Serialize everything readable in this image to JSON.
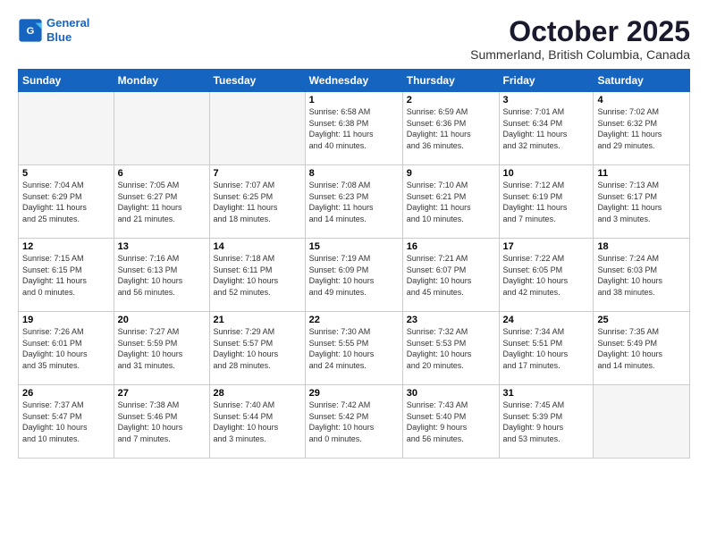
{
  "header": {
    "logo_line1": "General",
    "logo_line2": "Blue",
    "month": "October 2025",
    "location": "Summerland, British Columbia, Canada"
  },
  "weekdays": [
    "Sunday",
    "Monday",
    "Tuesday",
    "Wednesday",
    "Thursday",
    "Friday",
    "Saturday"
  ],
  "weeks": [
    [
      {
        "day": "",
        "info": ""
      },
      {
        "day": "",
        "info": ""
      },
      {
        "day": "",
        "info": ""
      },
      {
        "day": "1",
        "info": "Sunrise: 6:58 AM\nSunset: 6:38 PM\nDaylight: 11 hours\nand 40 minutes."
      },
      {
        "day": "2",
        "info": "Sunrise: 6:59 AM\nSunset: 6:36 PM\nDaylight: 11 hours\nand 36 minutes."
      },
      {
        "day": "3",
        "info": "Sunrise: 7:01 AM\nSunset: 6:34 PM\nDaylight: 11 hours\nand 32 minutes."
      },
      {
        "day": "4",
        "info": "Sunrise: 7:02 AM\nSunset: 6:32 PM\nDaylight: 11 hours\nand 29 minutes."
      }
    ],
    [
      {
        "day": "5",
        "info": "Sunrise: 7:04 AM\nSunset: 6:29 PM\nDaylight: 11 hours\nand 25 minutes."
      },
      {
        "day": "6",
        "info": "Sunrise: 7:05 AM\nSunset: 6:27 PM\nDaylight: 11 hours\nand 21 minutes."
      },
      {
        "day": "7",
        "info": "Sunrise: 7:07 AM\nSunset: 6:25 PM\nDaylight: 11 hours\nand 18 minutes."
      },
      {
        "day": "8",
        "info": "Sunrise: 7:08 AM\nSunset: 6:23 PM\nDaylight: 11 hours\nand 14 minutes."
      },
      {
        "day": "9",
        "info": "Sunrise: 7:10 AM\nSunset: 6:21 PM\nDaylight: 11 hours\nand 10 minutes."
      },
      {
        "day": "10",
        "info": "Sunrise: 7:12 AM\nSunset: 6:19 PM\nDaylight: 11 hours\nand 7 minutes."
      },
      {
        "day": "11",
        "info": "Sunrise: 7:13 AM\nSunset: 6:17 PM\nDaylight: 11 hours\nand 3 minutes."
      }
    ],
    [
      {
        "day": "12",
        "info": "Sunrise: 7:15 AM\nSunset: 6:15 PM\nDaylight: 11 hours\nand 0 minutes."
      },
      {
        "day": "13",
        "info": "Sunrise: 7:16 AM\nSunset: 6:13 PM\nDaylight: 10 hours\nand 56 minutes."
      },
      {
        "day": "14",
        "info": "Sunrise: 7:18 AM\nSunset: 6:11 PM\nDaylight: 10 hours\nand 52 minutes."
      },
      {
        "day": "15",
        "info": "Sunrise: 7:19 AM\nSunset: 6:09 PM\nDaylight: 10 hours\nand 49 minutes."
      },
      {
        "day": "16",
        "info": "Sunrise: 7:21 AM\nSunset: 6:07 PM\nDaylight: 10 hours\nand 45 minutes."
      },
      {
        "day": "17",
        "info": "Sunrise: 7:22 AM\nSunset: 6:05 PM\nDaylight: 10 hours\nand 42 minutes."
      },
      {
        "day": "18",
        "info": "Sunrise: 7:24 AM\nSunset: 6:03 PM\nDaylight: 10 hours\nand 38 minutes."
      }
    ],
    [
      {
        "day": "19",
        "info": "Sunrise: 7:26 AM\nSunset: 6:01 PM\nDaylight: 10 hours\nand 35 minutes."
      },
      {
        "day": "20",
        "info": "Sunrise: 7:27 AM\nSunset: 5:59 PM\nDaylight: 10 hours\nand 31 minutes."
      },
      {
        "day": "21",
        "info": "Sunrise: 7:29 AM\nSunset: 5:57 PM\nDaylight: 10 hours\nand 28 minutes."
      },
      {
        "day": "22",
        "info": "Sunrise: 7:30 AM\nSunset: 5:55 PM\nDaylight: 10 hours\nand 24 minutes."
      },
      {
        "day": "23",
        "info": "Sunrise: 7:32 AM\nSunset: 5:53 PM\nDaylight: 10 hours\nand 20 minutes."
      },
      {
        "day": "24",
        "info": "Sunrise: 7:34 AM\nSunset: 5:51 PM\nDaylight: 10 hours\nand 17 minutes."
      },
      {
        "day": "25",
        "info": "Sunrise: 7:35 AM\nSunset: 5:49 PM\nDaylight: 10 hours\nand 14 minutes."
      }
    ],
    [
      {
        "day": "26",
        "info": "Sunrise: 7:37 AM\nSunset: 5:47 PM\nDaylight: 10 hours\nand 10 minutes."
      },
      {
        "day": "27",
        "info": "Sunrise: 7:38 AM\nSunset: 5:46 PM\nDaylight: 10 hours\nand 7 minutes."
      },
      {
        "day": "28",
        "info": "Sunrise: 7:40 AM\nSunset: 5:44 PM\nDaylight: 10 hours\nand 3 minutes."
      },
      {
        "day": "29",
        "info": "Sunrise: 7:42 AM\nSunset: 5:42 PM\nDaylight: 10 hours\nand 0 minutes."
      },
      {
        "day": "30",
        "info": "Sunrise: 7:43 AM\nSunset: 5:40 PM\nDaylight: 9 hours\nand 56 minutes."
      },
      {
        "day": "31",
        "info": "Sunrise: 7:45 AM\nSunset: 5:39 PM\nDaylight: 9 hours\nand 53 minutes."
      },
      {
        "day": "",
        "info": ""
      }
    ]
  ]
}
